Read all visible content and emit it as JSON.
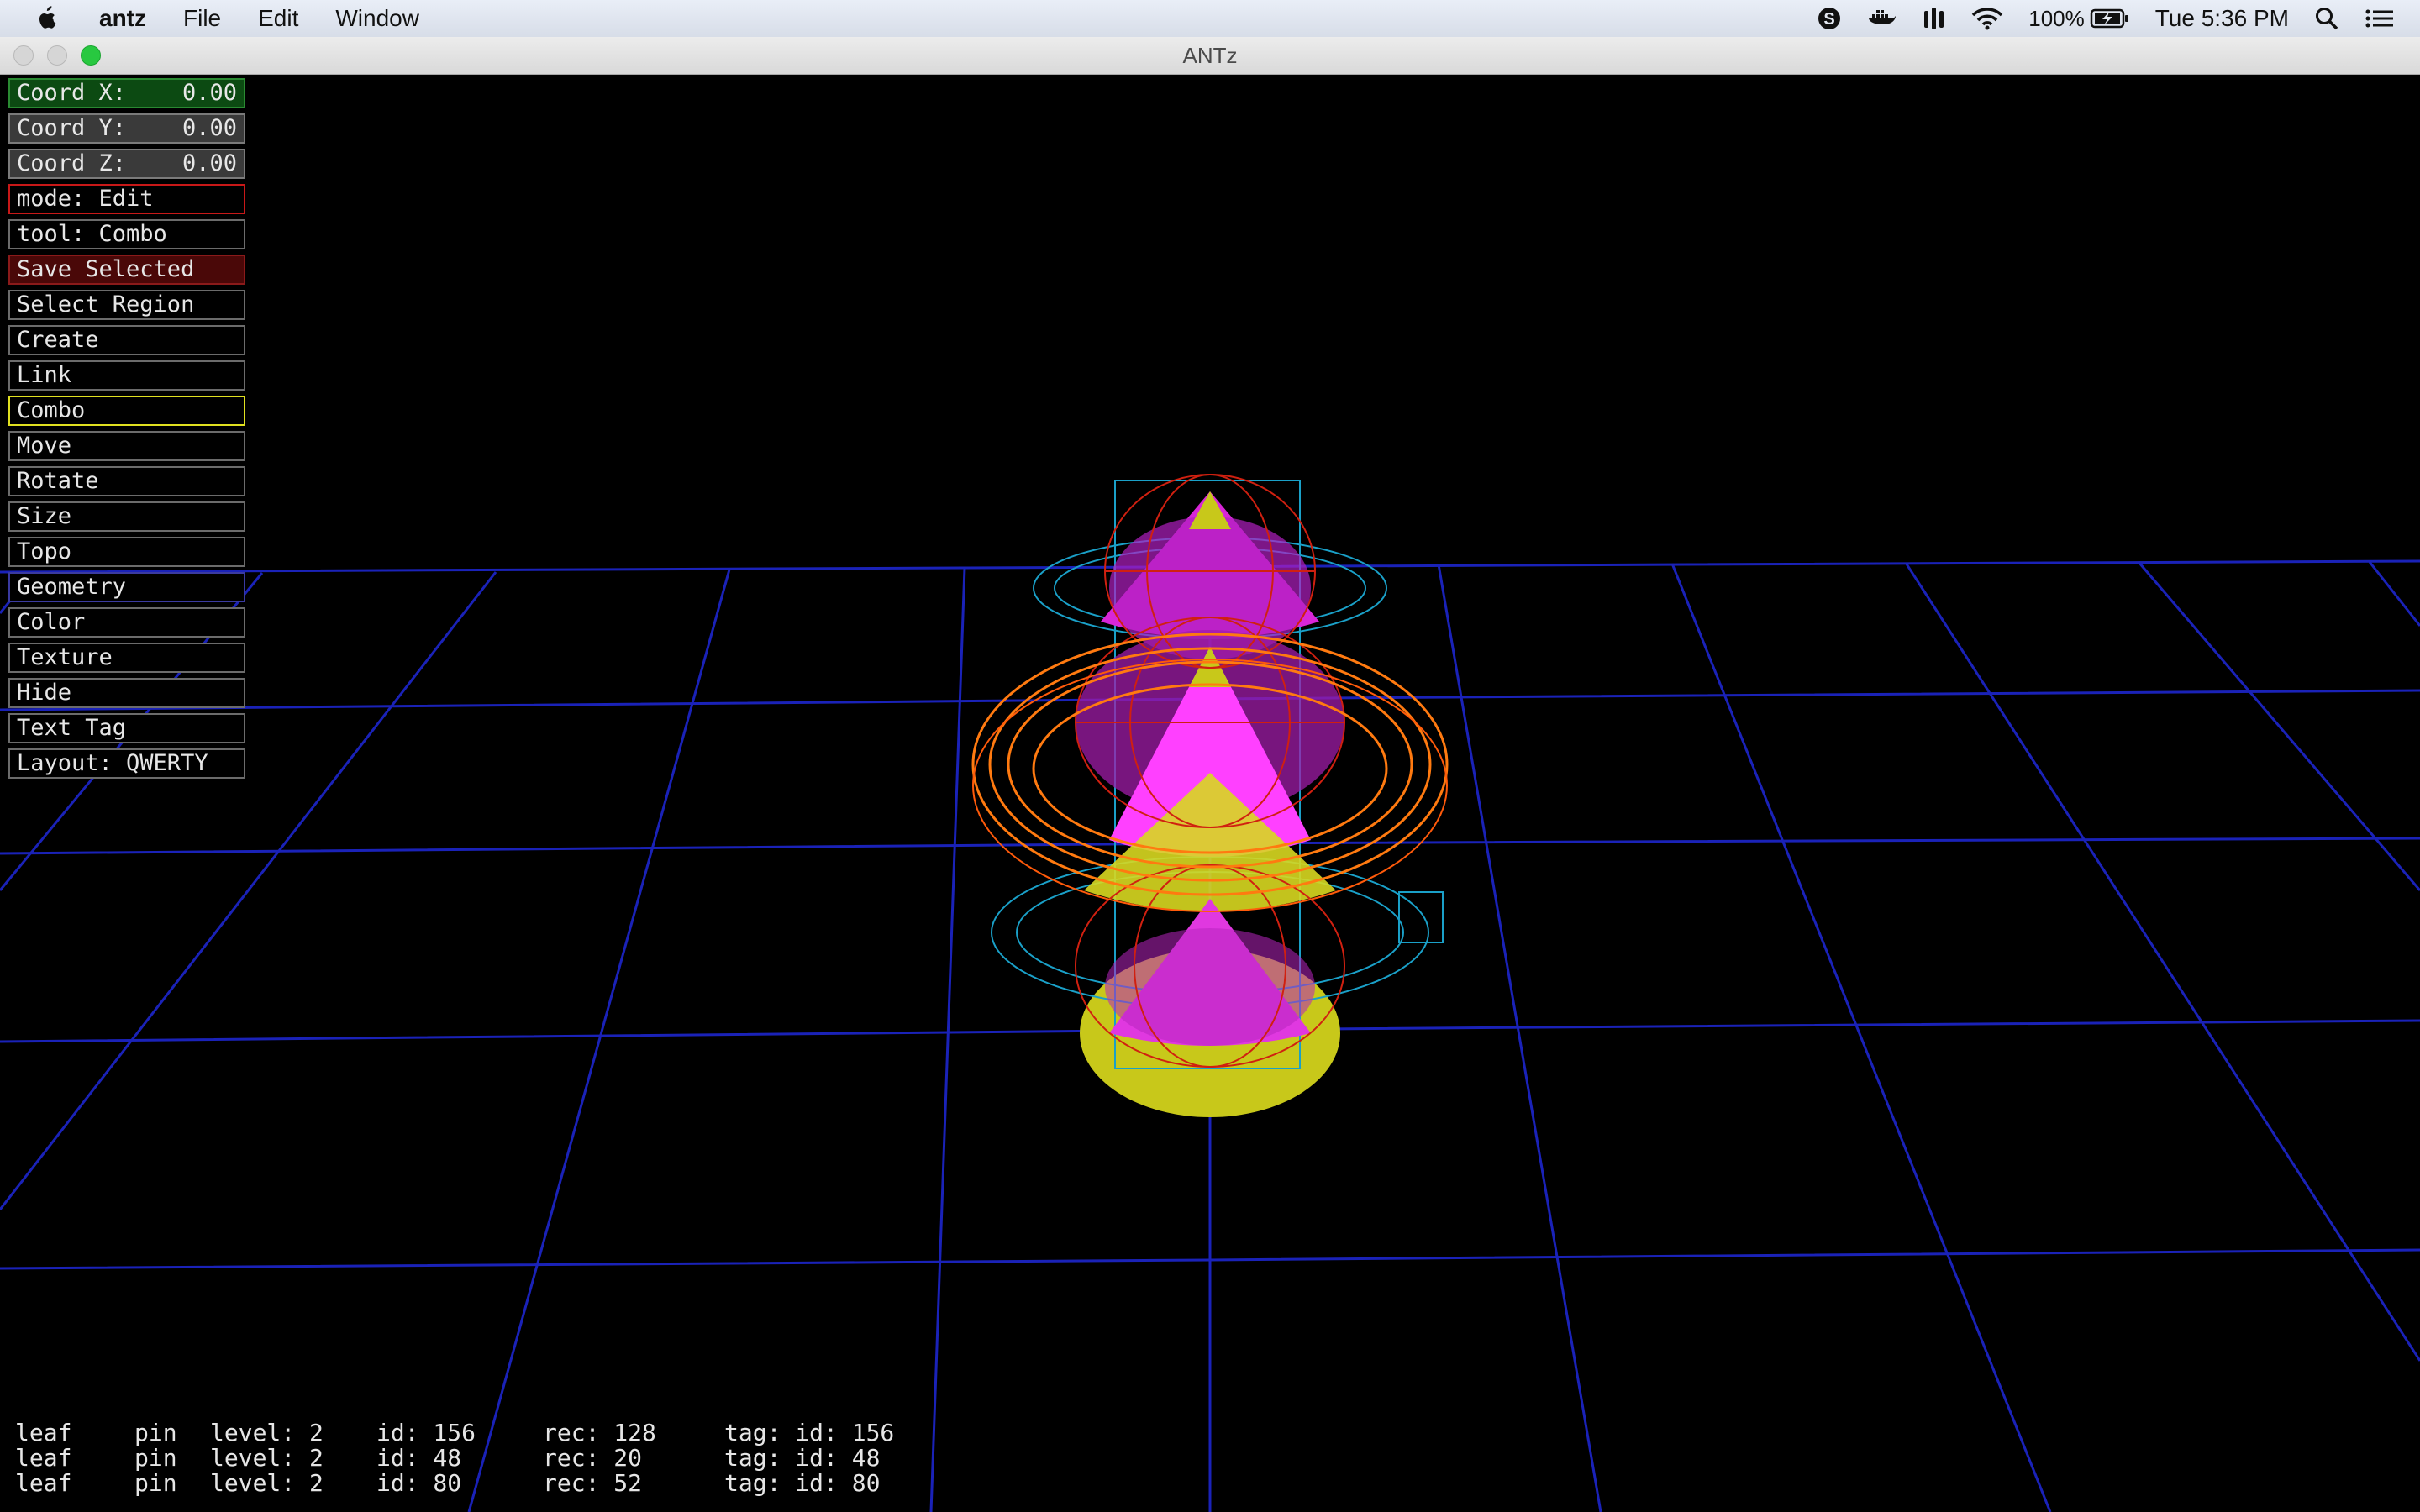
{
  "menubar": {
    "app_name": "antz",
    "menus": [
      "File",
      "Edit",
      "Window"
    ],
    "battery": "100%",
    "clock": "Tue 5:36 PM",
    "icons": [
      "apple-icon",
      "skype-icon",
      "docker-icon",
      "stats-icon",
      "wifi-icon",
      "battery-icon",
      "spotlight-icon",
      "notification-center-icon"
    ]
  },
  "window": {
    "title": "ANTz"
  },
  "panel": {
    "coord_x": {
      "label": "Coord X:",
      "value": "0.00"
    },
    "coord_y": {
      "label": "Coord Y:",
      "value": "0.00"
    },
    "coord_z": {
      "label": "Coord Z:",
      "value": "0.00"
    },
    "mode": "mode: Edit",
    "tool": "tool: Combo",
    "save_selected": "Save Selected",
    "select_region": "Select Region",
    "create": "Create",
    "link": "Link",
    "combo": "Combo",
    "move": "Move",
    "rotate": "Rotate",
    "size": "Size",
    "topo": "Topo",
    "geometry": "Geometry",
    "color": "Color",
    "texture": "Texture",
    "hide": "Hide",
    "text_tag": "Text Tag",
    "layout": "Layout: QWERTY"
  },
  "status": [
    {
      "type": "leaf",
      "kind": "pin",
      "level": "level: 2",
      "id": "id: 156",
      "rec": "rec: 128",
      "tag": "tag: id: 156"
    },
    {
      "type": "leaf",
      "kind": "pin",
      "level": "level: 2",
      "id": "id: 48",
      "rec": "rec: 20",
      "tag": "tag: id: 48"
    },
    {
      "type": "leaf",
      "kind": "pin",
      "level": "level: 2",
      "id": "id: 80",
      "rec": "rec: 52",
      "tag": "tag: id: 80"
    }
  ],
  "colors": {
    "grid": "#1a22b8",
    "coord_x_bg": "#0c4a12",
    "coord_bg": "#3a3a3a",
    "mode_border": "#c81818",
    "save_bg": "#4a0808",
    "combo_border": "#e0e020",
    "geometry_border": "#3a3aa0",
    "torus_orange": "#ff7a10",
    "wire_cyan": "#1aa0c8",
    "cone_magenta": "#ff40ff",
    "cone_yellow": "#d8d820"
  }
}
